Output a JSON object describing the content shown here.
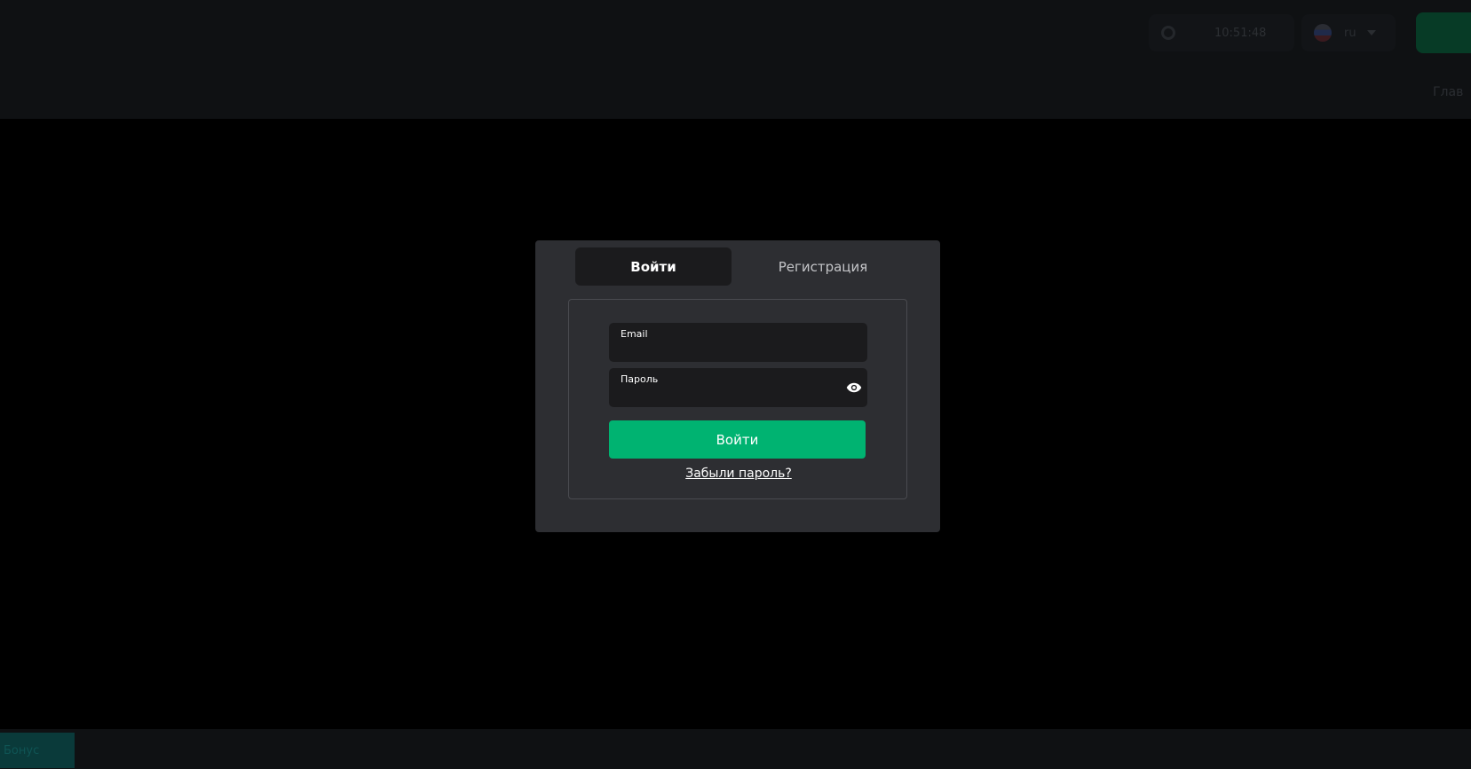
{
  "background": {
    "header": {
      "clock_text": "10:51:48",
      "language_code": "ru",
      "nav_fragment": "Глав"
    },
    "footer": {
      "button_label": "Бонус"
    }
  },
  "modal": {
    "tabs": [
      {
        "label": "Войти",
        "active": true
      },
      {
        "label": "Регистрация",
        "active": false
      }
    ],
    "form": {
      "email_label": "Email",
      "email_value": "",
      "password_label": "Пароль",
      "password_value": "",
      "submit_label": "Войти",
      "forgot_label": "Забыли пароль?"
    }
  },
  "colors": {
    "accent": "#00b371",
    "modal_bg": "#2d2e32",
    "field_bg": "#1b1b1d"
  },
  "icons": {
    "password_toggle": "eye-icon",
    "settings": "gear-icon",
    "flag": "flag-icon",
    "dropdown": "chevron-down-icon"
  }
}
